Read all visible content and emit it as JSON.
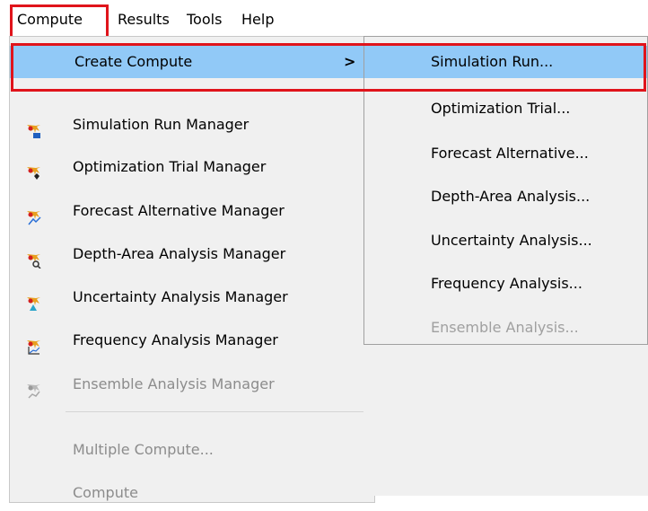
{
  "menubar": {
    "items": [
      "Compute",
      "Results",
      "Tools",
      "Help"
    ]
  },
  "compute_menu": {
    "create_compute": "Create Compute",
    "items": [
      {
        "label": "Simulation Run Manager",
        "icon": "simulation-run-icon",
        "enabled": true
      },
      {
        "label": "Optimization Trial Manager",
        "icon": "optimization-trial-icon",
        "enabled": true
      },
      {
        "label": "Forecast Alternative Manager",
        "icon": "forecast-alternative-icon",
        "enabled": true
      },
      {
        "label": "Depth-Area Analysis Manager",
        "icon": "depth-area-analysis-icon",
        "enabled": true
      },
      {
        "label": "Uncertainty Analysis Manager",
        "icon": "uncertainty-analysis-icon",
        "enabled": true
      },
      {
        "label": "Frequency Analysis Manager",
        "icon": "frequency-analysis-icon",
        "enabled": true
      },
      {
        "label": "Ensemble Analysis Manager",
        "icon": "ensemble-analysis-icon",
        "enabled": false
      }
    ],
    "multiple_compute": "Multiple Compute...",
    "compute": "Compute"
  },
  "create_compute_submenu": {
    "items": [
      {
        "label": "Simulation Run...",
        "enabled": true
      },
      {
        "label": "Optimization Trial...",
        "enabled": true
      },
      {
        "label": "Forecast Alternative...",
        "enabled": true
      },
      {
        "label": "Depth-Area Analysis...",
        "enabled": true
      },
      {
        "label": "Uncertainty Analysis...",
        "enabled": true
      },
      {
        "label": "Frequency Analysis...",
        "enabled": true
      },
      {
        "label": "Ensemble Analysis...",
        "enabled": false
      }
    ]
  },
  "colors": {
    "highlight": "#91c9f7",
    "annotation_box": "#e0141b",
    "disabled_text": "#8c8c8c"
  }
}
